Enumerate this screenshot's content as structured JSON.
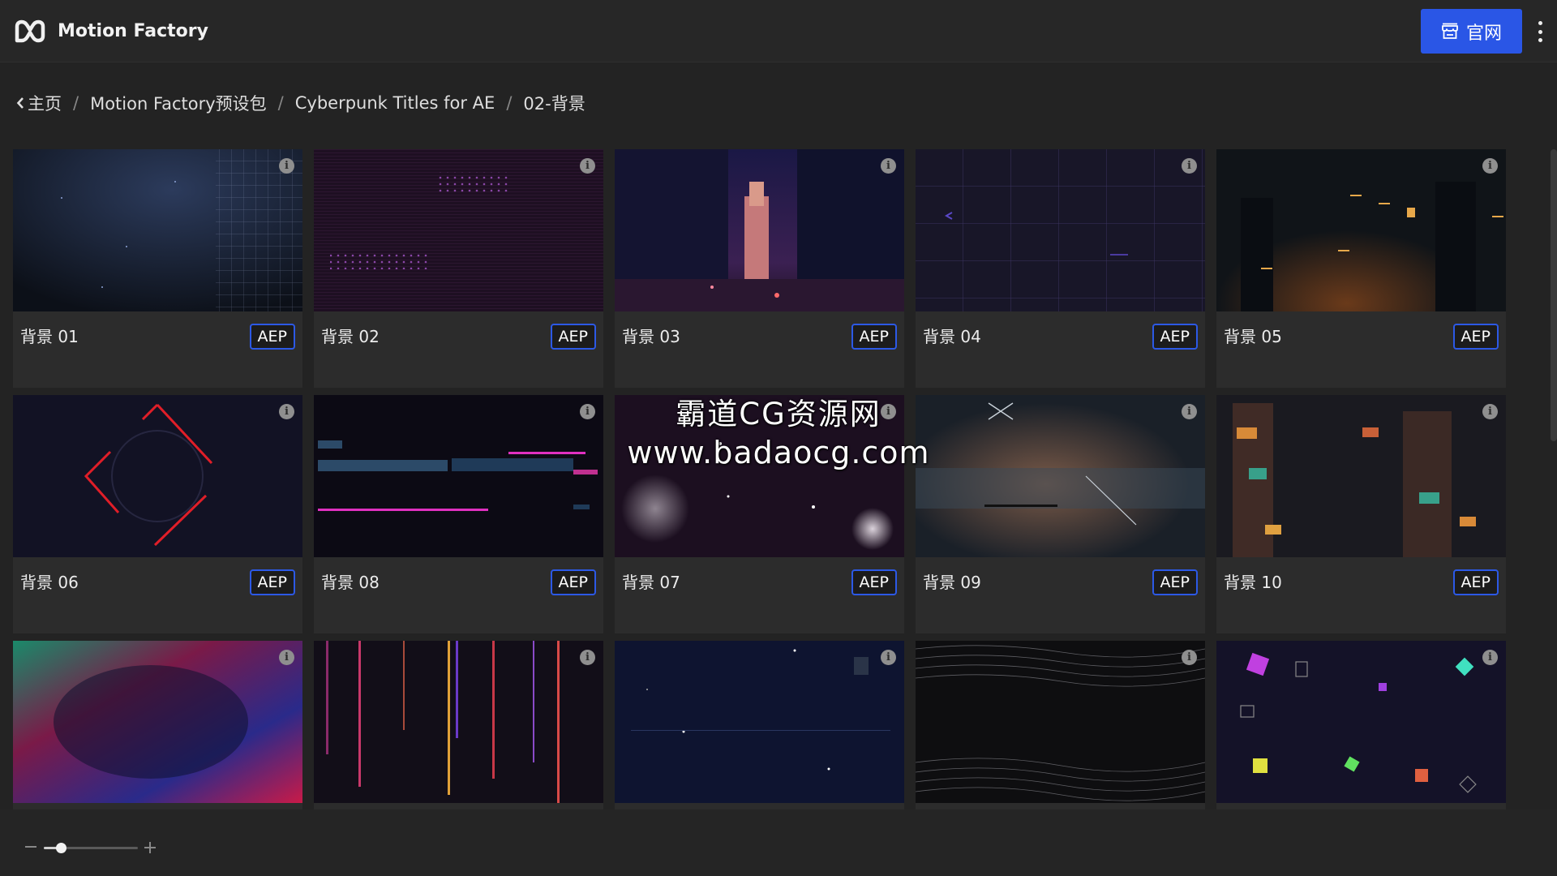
{
  "header": {
    "app_name": "Motion Factory",
    "site_button_label": "官网",
    "logo_icon": "mf-logo-icon",
    "site_icon": "storefront-icon",
    "menu_icon": "vertical-dots-icon"
  },
  "breadcrumb": {
    "items": [
      "主页",
      "Motion Factory预设包",
      "Cyberpunk Titles for AE",
      "02-背景"
    ],
    "separator": "/"
  },
  "cards": [
    {
      "title": "背景 01",
      "badge": "AEP"
    },
    {
      "title": "背景 02",
      "badge": "AEP"
    },
    {
      "title": "背景 03",
      "badge": "AEP"
    },
    {
      "title": "背景 04",
      "badge": "AEP"
    },
    {
      "title": "背景 05",
      "badge": "AEP"
    },
    {
      "title": "背景 06",
      "badge": "AEP"
    },
    {
      "title": "背景 08",
      "badge": "AEP"
    },
    {
      "title": "背景 07",
      "badge": "AEP"
    },
    {
      "title": "背景 09",
      "badge": "AEP"
    },
    {
      "title": "背景 10",
      "badge": "AEP"
    },
    {
      "title": "",
      "badge": ""
    },
    {
      "title": "",
      "badge": ""
    },
    {
      "title": "",
      "badge": ""
    },
    {
      "title": "",
      "badge": ""
    },
    {
      "title": "",
      "badge": ""
    }
  ],
  "info_glyph": "i",
  "watermark": {
    "line1": "霸道CG资源网",
    "line2": "www.badaocg.com"
  },
  "zoom": {
    "level": 0.18
  },
  "colors": {
    "accent": "#2a56e6",
    "background": "#232323",
    "card": "#2c2c2c"
  }
}
